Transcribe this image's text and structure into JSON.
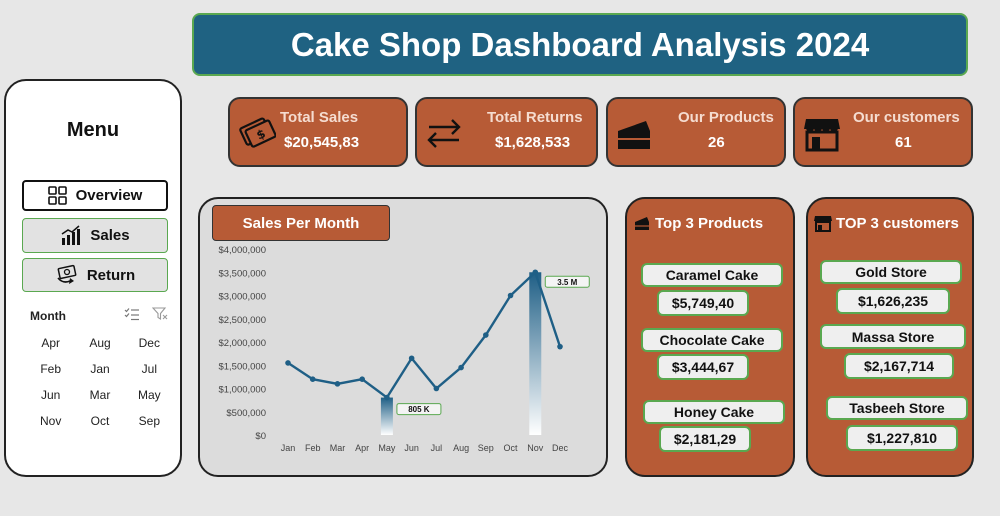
{
  "header": {
    "title": "Cake Shop Dashboard Analysis 2024"
  },
  "menu": {
    "title": "Menu",
    "buttons": [
      {
        "label": "Overview",
        "icon": "grid-icon"
      },
      {
        "label": "Sales",
        "icon": "bar-chart-icon"
      },
      {
        "label": "Return",
        "icon": "return-money-icon"
      }
    ],
    "month_header": "Month",
    "months": [
      "Apr",
      "Aug",
      "Dec",
      "Feb",
      "Jan",
      "Jul",
      "Jun",
      "Mar",
      "May",
      "Nov",
      "Oct",
      "Sep"
    ]
  },
  "kpis": [
    {
      "label": "Total Sales",
      "value": "$20,545,83",
      "icon": "money-icon"
    },
    {
      "label": "Total Returns",
      "value": "$1,628,533",
      "icon": "exchange-arrows-icon"
    },
    {
      "label": "Our Products",
      "value": "26",
      "icon": "cake-slice-icon"
    },
    {
      "label": "Our customers",
      "value": "61",
      "icon": "store-icon"
    }
  ],
  "chart": {
    "tab_label": "Sales Per Month"
  },
  "chart_data": {
    "type": "line",
    "categories": [
      "Jan",
      "Feb",
      "Mar",
      "Apr",
      "May",
      "Jun",
      "Jul",
      "Aug",
      "Sep",
      "Oct",
      "Nov",
      "Dec"
    ],
    "values": [
      1550000,
      1200000,
      1100000,
      1200000,
      805000,
      1650000,
      1000000,
      1450000,
      2150000,
      3000000,
      3500000,
      1900000
    ],
    "ylim": [
      0,
      4000000
    ],
    "yticks": [
      "$0",
      "$500,000",
      "$1,000,000",
      "$1,500,000",
      "$2,000,000",
      "$2,500,000",
      "$3,000,000",
      "$3,500,000",
      "$4,000,000"
    ],
    "annotations": [
      {
        "month": "May",
        "label": "805 K"
      },
      {
        "month": "Nov",
        "label": "3.5 M"
      }
    ],
    "line_color": "#1f5f86"
  },
  "top_products": {
    "title": "Top 3  Products",
    "items": [
      {
        "name": "Caramel Cake",
        "value": "$5,749,40"
      },
      {
        "name": "Chocolate Cake",
        "value": "$3,444,67"
      },
      {
        "name": "Honey Cake",
        "value": "$2,181,29"
      }
    ]
  },
  "top_customers": {
    "title": "TOP 3 customers",
    "items": [
      {
        "name": "Gold Store",
        "value": "$1,626,235"
      },
      {
        "name": "Massa Store",
        "value": "$2,167,714"
      },
      {
        "name": "Tasbeeh Store",
        "value": "$1,227,810"
      }
    ]
  },
  "colors": {
    "accent": "#b75b36",
    "header": "#1f6282",
    "border_green": "#5aa850"
  }
}
